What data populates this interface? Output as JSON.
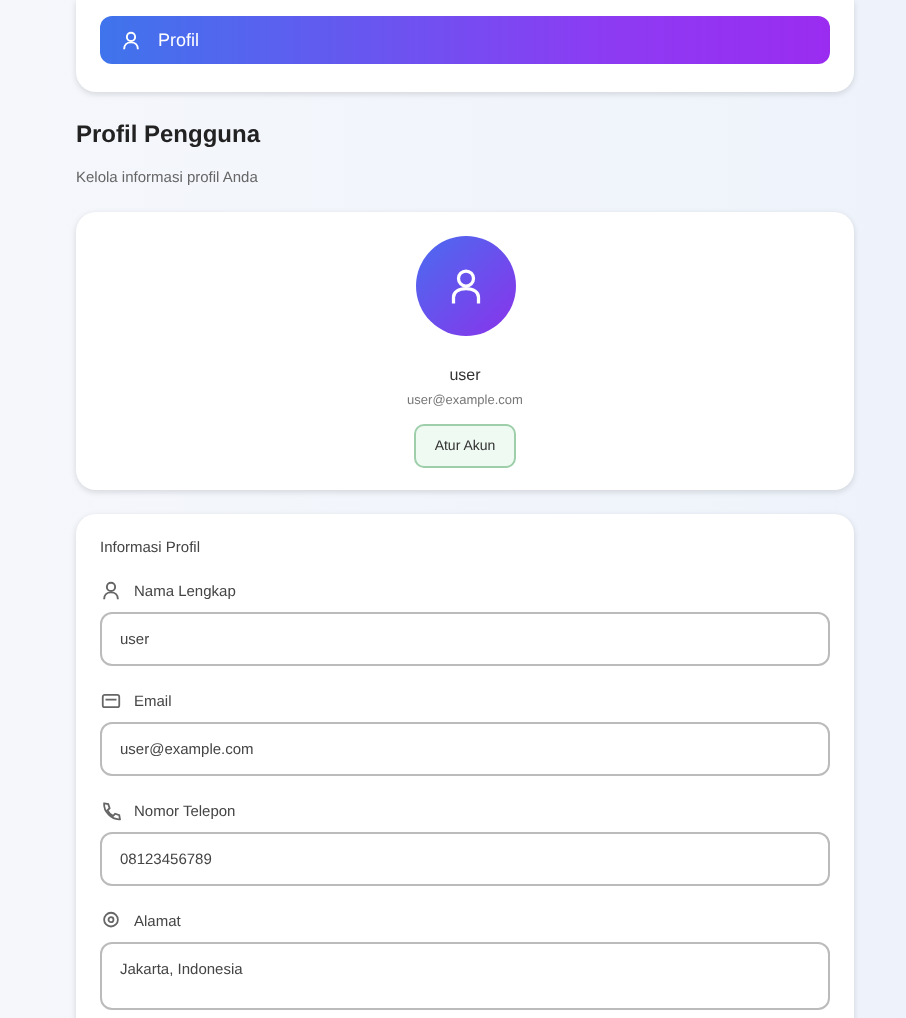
{
  "nav": {
    "items": [
      {
        "label": "Profil",
        "selected": true
      }
    ]
  },
  "header": {
    "title": "Profil Pengguna",
    "subtitle": "Kelola informasi profil Anda"
  },
  "profile_card": {
    "name": "user",
    "email": "user@example.com",
    "button": "Atur Akun"
  },
  "info_card": {
    "title": "Informasi Profil",
    "fields": [
      {
        "kind": "person",
        "label": "Nama Lengkap",
        "value": "user"
      },
      {
        "kind": "mail",
        "label": "Email",
        "value": "user@example.com"
      },
      {
        "kind": "phone",
        "label": "Nomor Telepon",
        "value": "08123456789"
      },
      {
        "kind": "pin",
        "label": "Alamat",
        "value": "Jakarta, Indonesia",
        "multiline": true
      }
    ]
  }
}
